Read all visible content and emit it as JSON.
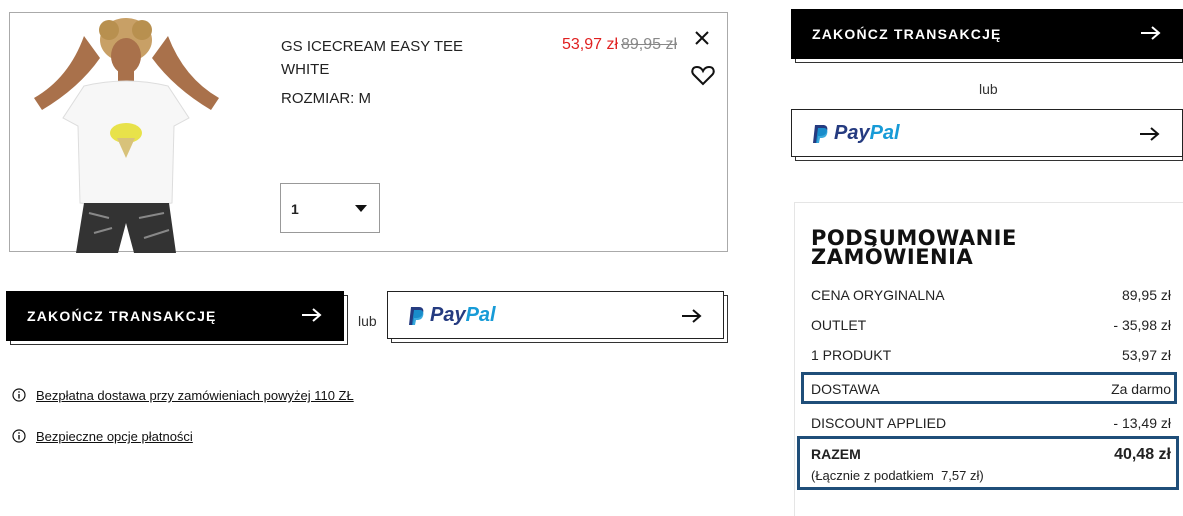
{
  "product": {
    "name": "GS ICECREAM EASY TEE WHITE",
    "size": "ROZMIAR: M",
    "price_sale": "53,97 zł",
    "price_original": "89,95 zł",
    "quantity": "1"
  },
  "buttons": {
    "checkout_label": "ZAKOŃCZ TRANSAKCJĘ",
    "or_label": "lub",
    "paypal_brand_p": "Pay",
    "paypal_brand_pal": "Pal"
  },
  "info": {
    "free_delivery": "Bezpłatna dostawa przy zamówieniach powyżej 110 ZŁ",
    "secure_payment": "Bezpieczne opcje płatności"
  },
  "summary": {
    "title_line1": "PODSUMOWANIE",
    "title_line2": "ZAMÓWIENIA",
    "rows": [
      {
        "label": "CENA ORYGINALNA",
        "value": "89,95 zł"
      },
      {
        "label": "OUTLET",
        "value": "- 35,98 zł"
      },
      {
        "label": "1 PRODUKT",
        "value": "53,97 zł"
      },
      {
        "label": "DOSTAWA",
        "value": "Za darmo"
      },
      {
        "label": "DISCOUNT APPLIED",
        "value": "- 13,49 zł"
      }
    ],
    "total_label": "RAZEM",
    "total_value": "40,48 zł",
    "tax_note": "(Łącznie z podatkiem  7,57 zł)"
  },
  "colors": {
    "sale_price": "#e02020",
    "highlight_border": "#1f4e79",
    "paypal_dark": "#253b80",
    "paypal_light": "#179bd7"
  }
}
